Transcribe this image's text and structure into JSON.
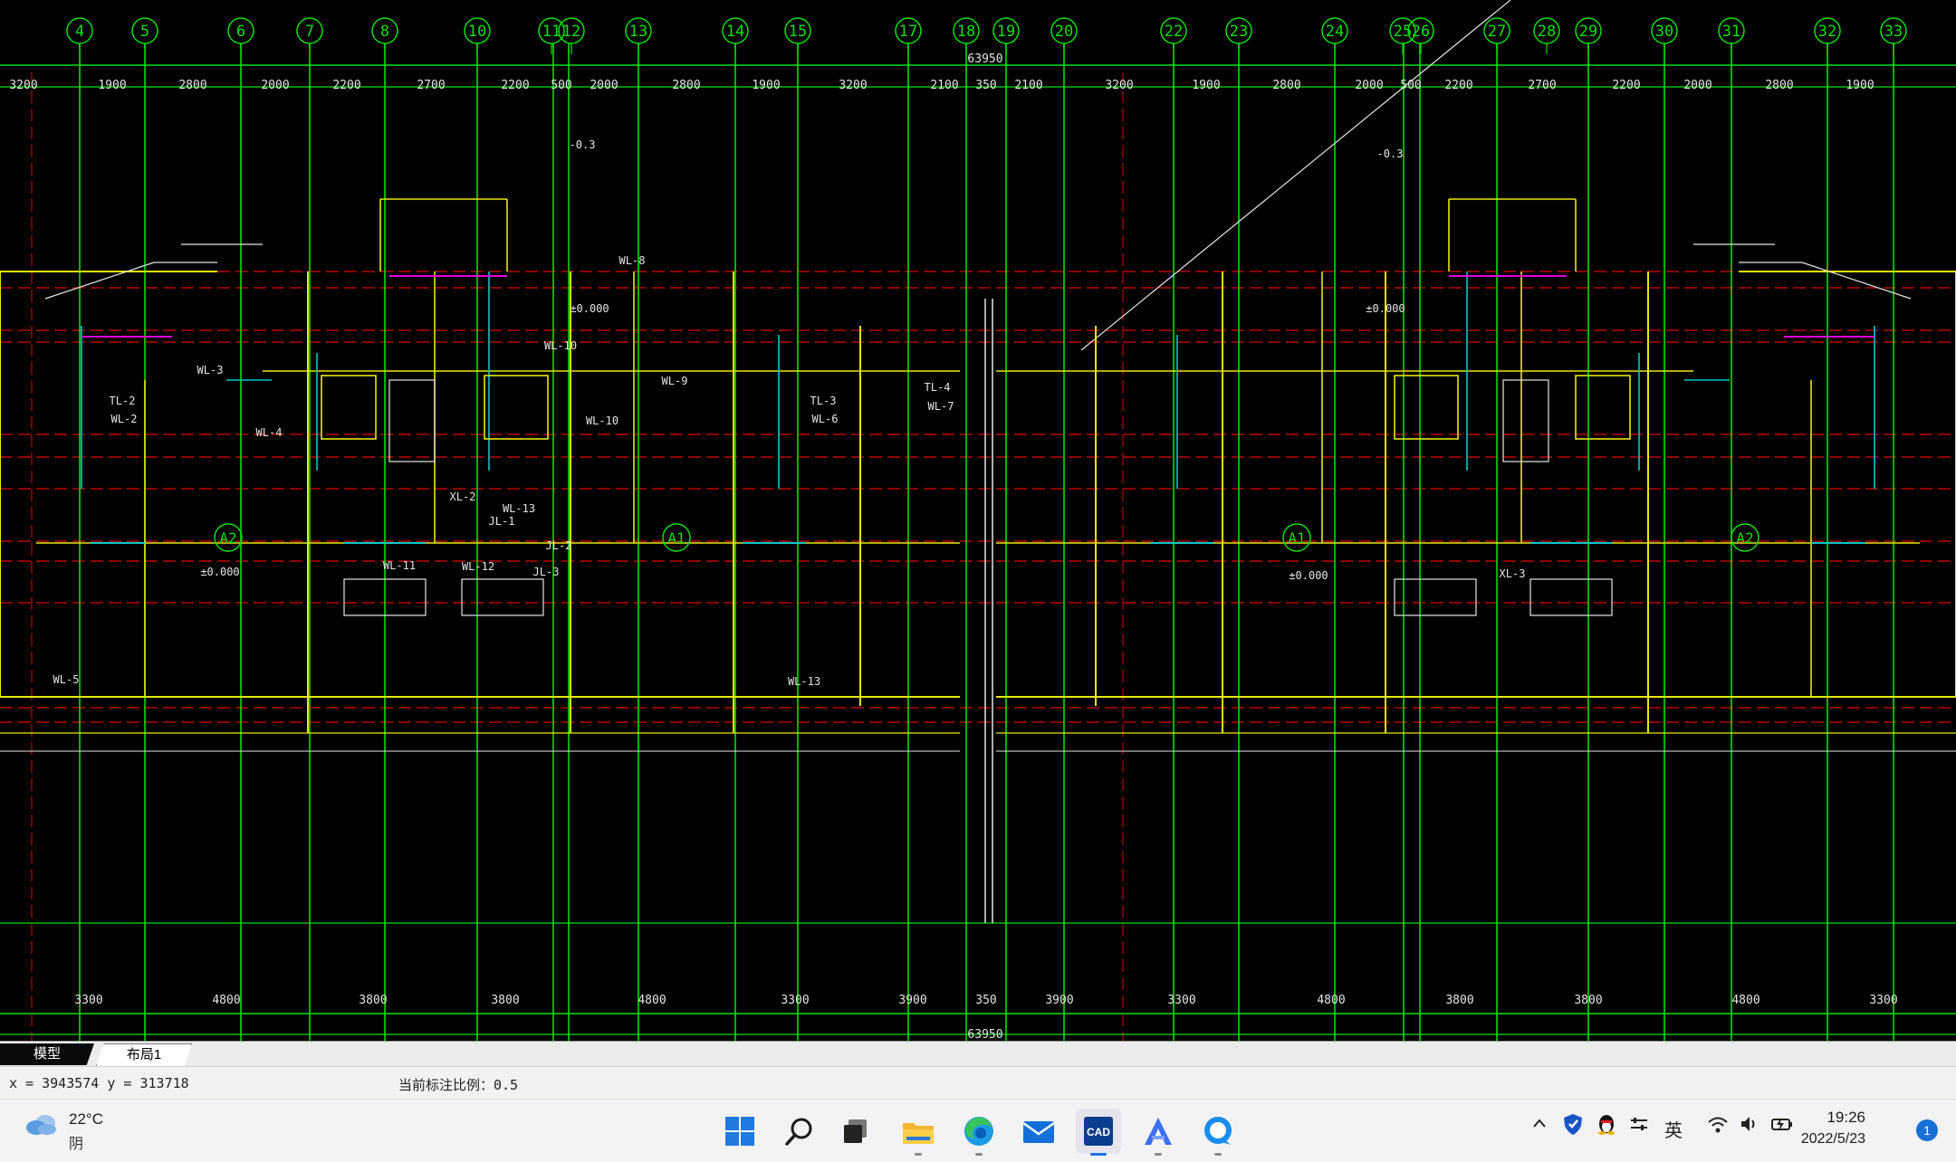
{
  "grid_axes": [
    "4",
    "5",
    "6",
    "7",
    "8",
    "10",
    "11",
    "12",
    "13",
    "14",
    "15",
    "17",
    "18",
    "19",
    "20",
    "22",
    "23",
    "24",
    "25",
    "26",
    "27",
    "28",
    "29",
    "30",
    "31",
    "32",
    "33"
  ],
  "top_dims": [
    "3200",
    "1900",
    "2800",
    "2000",
    "2200",
    "2700",
    "2200",
    "500",
    "2000",
    "2800",
    "1900",
    "3200",
    "2100",
    "350",
    "2100",
    "3200",
    "1900",
    "2800",
    "2000",
    "500",
    "2200",
    "2700",
    "2200",
    "2000",
    "2800",
    "1900"
  ],
  "bottom_dims": [
    "3300",
    "4800",
    "3800",
    "3800",
    "4800",
    "3300",
    "3900",
    "350",
    "3900",
    "3300",
    "4800",
    "3800",
    "3800",
    "4800",
    "3300"
  ],
  "total_dim": "63950",
  "unit_labels": [
    "A2",
    "A1",
    "A1",
    "A2"
  ],
  "elevations": [
    "-0.3",
    "-0.3",
    "±0.000",
    "±0.000",
    "±0.000",
    "±0.000"
  ],
  "pipe_labels": [
    "WL-8",
    "WL-10",
    "WL-10",
    "WL-9",
    "WL-3",
    "TL-2",
    "WL-2",
    "WL-4",
    "TL-3",
    "WL-6",
    "TL-4",
    "WL-7",
    "XL-2",
    "WL-13",
    "JL-1",
    "JL-2",
    "JL-3",
    "WL-11",
    "WL-12",
    "WL-5",
    "WL-13",
    "XL-3"
  ],
  "tabs": {
    "model": "模型",
    "layout1": "布局1"
  },
  "status": {
    "coords": "x = 3943574  y = 313718",
    "scale": "当前标注比例：0.5"
  },
  "taskbar": {
    "weather_temp": "22°C",
    "weather_desc": "阴",
    "input_method": "英",
    "time": "19:26",
    "date": "2022/5/23",
    "notifications": "1",
    "cad_icon_text": "CAD"
  },
  "colors": {
    "grid": "#00e000",
    "axis": "#e00000",
    "wall": "#e8e800",
    "cyan": "#00c8c8",
    "white": "#e6e6e6",
    "magenta": "#e000e0",
    "brand_blue": "#1a73e8"
  }
}
